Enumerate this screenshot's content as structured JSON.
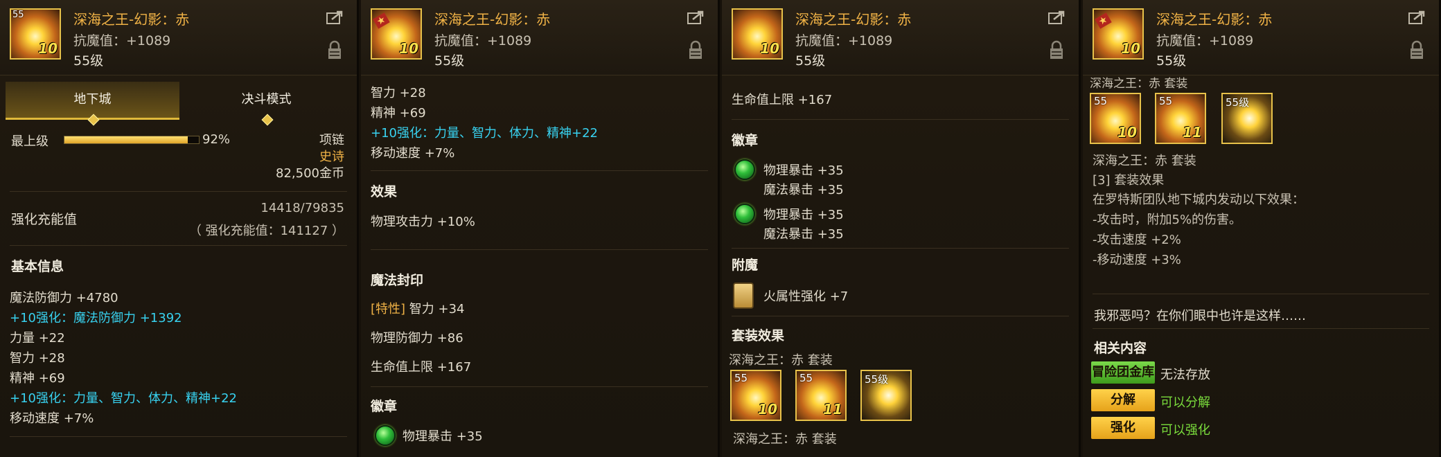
{
  "item": {
    "name": "深海之王-幻影：赤",
    "resist": "抗魔值：+1089",
    "level": "55级",
    "icon_level_tag": "55",
    "icon_plus": "10"
  },
  "panel1": {
    "tabs": [
      "地下城",
      "决斗模式"
    ],
    "grade_label": "最上级",
    "grade_percent": "92%",
    "grade_fraction": 0.92,
    "slot": "项链",
    "rarity": "史诗",
    "price": "82,500金币",
    "charge_label": "强化充能值",
    "charge_value": "14418/79835",
    "charge_note": "（ 强化充能值：141127 ）",
    "basic_info_title": "基本信息",
    "stats": [
      {
        "text": "魔法防御力 +4780",
        "color": "white"
      },
      {
        "text": "+10强化：魔法防御力 +1392",
        "color": "cyan"
      },
      {
        "text": "力量 +22",
        "color": "white"
      },
      {
        "text": "智力 +28",
        "color": "white"
      },
      {
        "text": "精神 +69",
        "color": "white"
      },
      {
        "text": "+10强化：力量、智力、体力、精神+22",
        "color": "cyan"
      },
      {
        "text": "移动速度 +7%",
        "color": "white"
      }
    ]
  },
  "panel2": {
    "lines": [
      "智力 +28",
      "精神 +69",
      "+10强化：力量、智力、体力、精神+22",
      "移动速度 +7%"
    ],
    "effect_title": "效果",
    "effect_line": "物理攻击力 +10%",
    "seal_title": "魔法封印",
    "seal_trait_tag": "[特性]",
    "seal_trait": "智力 +34",
    "seal_line2": "物理防御力 +86",
    "seal_line3": "生命值上限 +167",
    "emblem_title": "徽章",
    "emblem_line": "物理暴击 +35"
  },
  "panel3": {
    "hp_line": "生命值上限 +167",
    "emblem_title": "徽章",
    "emblem1": [
      "物理暴击 +35",
      "魔法暴击 +35"
    ],
    "emblem2": [
      "物理暴击 +35",
      "魔法暴击 +35"
    ],
    "enchant_title": "附魔",
    "enchant_line": "火属性强化 +7",
    "set_title": "套装效果",
    "set_name": "深海之王：赤 套装",
    "set_icons": [
      {
        "tag": "55",
        "plus": "10"
      },
      {
        "tag": "55",
        "plus": "11"
      },
      {
        "tag": "55级",
        "plus": ""
      }
    ],
    "set_name_bottom": "深海之王：赤 套装"
  },
  "panel4": {
    "set_name_top": "深海之王：赤 套装",
    "set_icons": [
      {
        "tag": "55",
        "plus": "10"
      },
      {
        "tag": "55",
        "plus": "11"
      },
      {
        "tag": "55级",
        "plus": ""
      }
    ],
    "set_name": "深海之王：赤 套装",
    "set_effect_title": "[3] 套装效果",
    "set_effect_lines": [
      "在罗特斯团队地下城内发动以下效果：",
      "-攻击时，附加5%的伤害。",
      "-攻击速度 +2%",
      "-移动速度 +3%"
    ],
    "flavor": "我邪恶吗？在你们眼中也许是这样……",
    "related_title": "相关内容",
    "actions": [
      {
        "button": "冒险团金库",
        "desc": "无法存放",
        "style": "green"
      },
      {
        "button": "分解",
        "desc": "可以分解",
        "style": "yellow"
      },
      {
        "button": "强化",
        "desc": "可以强化",
        "style": "yellow"
      }
    ]
  },
  "colors": {
    "accent_gold": "#f0b246",
    "stat_cyan": "#38d2f0",
    "ok_green": "#7adc3c"
  }
}
